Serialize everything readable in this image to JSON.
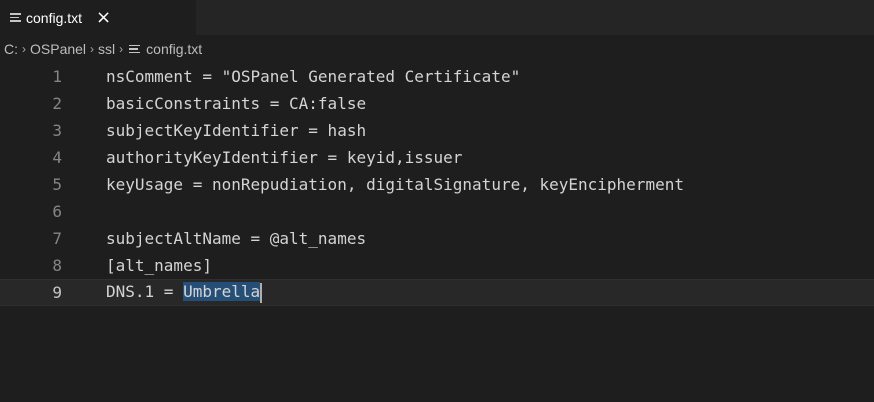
{
  "tab": {
    "icon": "text-file-lines-icon",
    "label": "config.txt",
    "close_icon": "close-icon",
    "close_glyph": "×"
  },
  "breadcrumb": {
    "items": [
      "C:",
      "OSPanel",
      "ssl",
      "config.txt"
    ],
    "separator": "›"
  },
  "editor": {
    "current_line": 9,
    "lines": [
      {
        "number": "1",
        "text": "nsComment = \"OSPanel Generated Certificate\""
      },
      {
        "number": "2",
        "text": "basicConstraints = CA:false"
      },
      {
        "number": "3",
        "text": "subjectKeyIdentifier = hash"
      },
      {
        "number": "4",
        "text": "authorityKeyIdentifier = keyid,issuer"
      },
      {
        "number": "5",
        "text": "keyUsage = nonRepudiation, digitalSignature, keyEncipherment"
      },
      {
        "number": "6",
        "text": ""
      },
      {
        "number": "7",
        "text": "subjectAltName = @alt_names"
      },
      {
        "number": "8",
        "text": "[alt_names]"
      },
      {
        "number": "9",
        "text_before": "DNS.1 = ",
        "text_selected": "Umbrella"
      }
    ]
  },
  "colors": {
    "background": "#1e1e1e",
    "tabbar": "#252526",
    "text": "#d4d4d4",
    "line_number": "#858585",
    "selection": "#264f78"
  }
}
